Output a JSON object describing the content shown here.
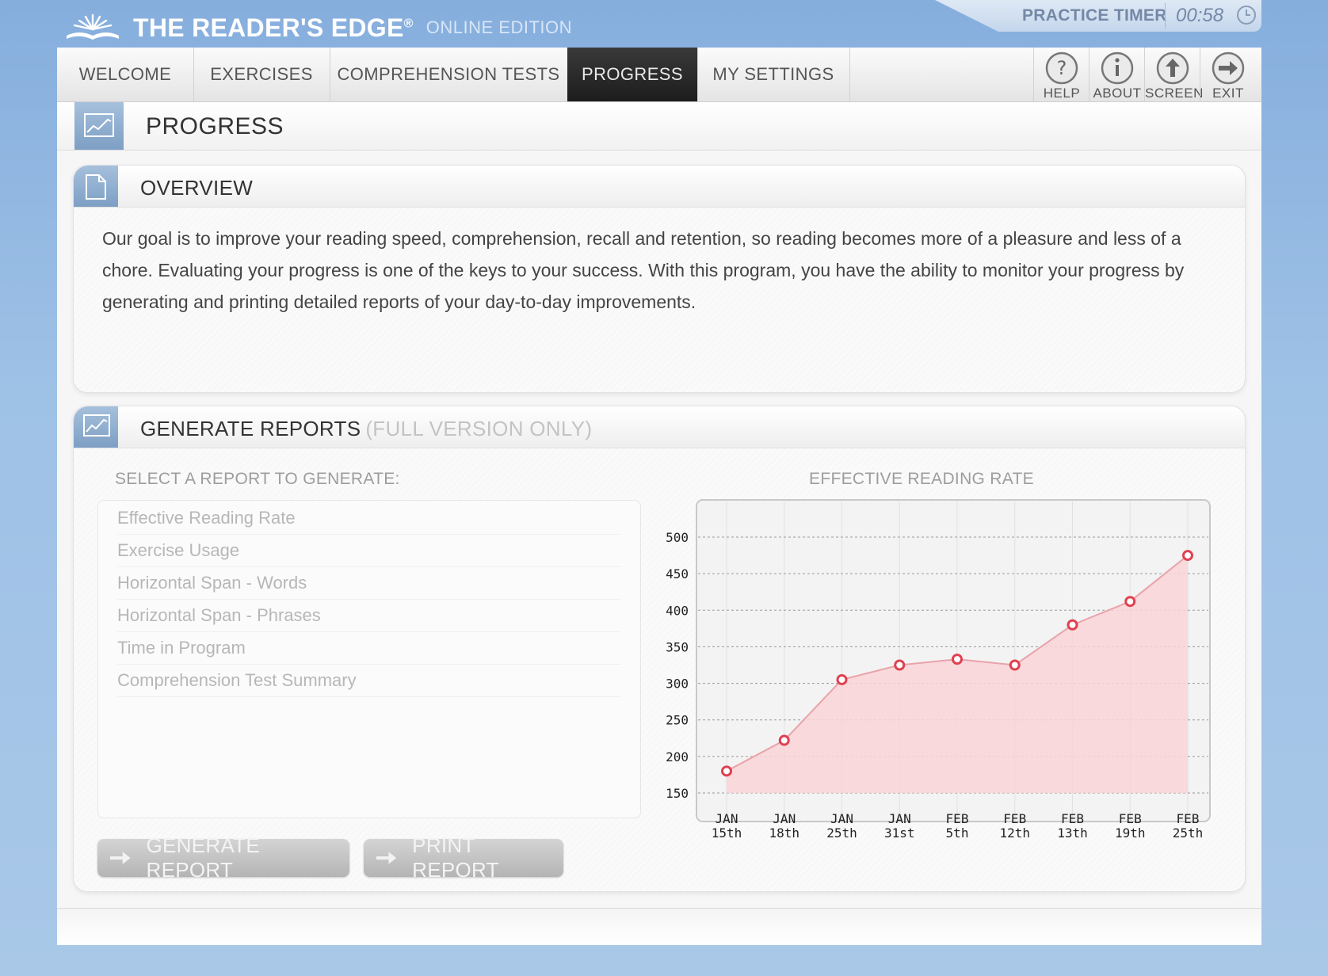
{
  "brand": {
    "name": "THE READER'S EDGE",
    "reg": "®",
    "edition": "ONLINE EDITION"
  },
  "timer": {
    "label": "PRACTICE TIMER",
    "value": "00:58"
  },
  "nav": {
    "tabs": [
      {
        "label": "WELCOME"
      },
      {
        "label": "EXERCISES"
      },
      {
        "label": "COMPREHENSION TESTS"
      },
      {
        "label": "PROGRESS",
        "active": true
      },
      {
        "label": "MY SETTINGS"
      }
    ],
    "tools": [
      {
        "label": "HELP",
        "icon": "help-icon"
      },
      {
        "label": "ABOUT",
        "icon": "info-icon"
      },
      {
        "label": "SCREEN",
        "icon": "screen-icon"
      },
      {
        "label": "EXIT",
        "icon": "exit-icon"
      }
    ]
  },
  "page": {
    "title": "PROGRESS",
    "icon": "chart-icon"
  },
  "overview": {
    "title": "OVERVIEW",
    "text": "Our goal is to improve your reading speed, comprehension, recall and retention, so reading becomes more of a pleasure and less of a chore. Evaluating your progress is one of the keys to your success. With this program, you have the ability to monitor your progress by generating and printing detailed reports of your day-to-day improvements."
  },
  "reports": {
    "title": "GENERATE REPORTS",
    "note": "(FULL VERSION ONLY)",
    "select_label": "SELECT A REPORT TO GENERATE:",
    "items": [
      "Effective Reading Rate",
      "Exercise Usage",
      "Horizontal Span - Words",
      "Horizontal Span - Phrases",
      "Time in Program",
      "Comprehension Test Summary"
    ],
    "generate_label": "GENERATE REPORT",
    "print_label": "PRINT REPORT"
  },
  "colors": {
    "accent": "#e04050",
    "fill": "#f9d4d6",
    "tab_active": "#262626",
    "header_blue": "#8fb0d4"
  },
  "chart_data": {
    "type": "area",
    "title": "EFFECTIVE READING RATE",
    "categories": [
      [
        "JAN",
        "15th"
      ],
      [
        "JAN",
        "18th"
      ],
      [
        "JAN",
        "25th"
      ],
      [
        "JAN",
        "31st"
      ],
      [
        "FEB",
        "5th"
      ],
      [
        "FEB",
        "12th"
      ],
      [
        "FEB",
        "13th"
      ],
      [
        "FEB",
        "19th"
      ],
      [
        "FEB",
        "25th"
      ]
    ],
    "values": [
      180,
      222,
      305,
      325,
      333,
      325,
      380,
      412,
      475
    ],
    "yticks": [
      150,
      200,
      250,
      300,
      350,
      400,
      450,
      500
    ],
    "ylim": [
      150,
      500
    ],
    "grid": true
  }
}
